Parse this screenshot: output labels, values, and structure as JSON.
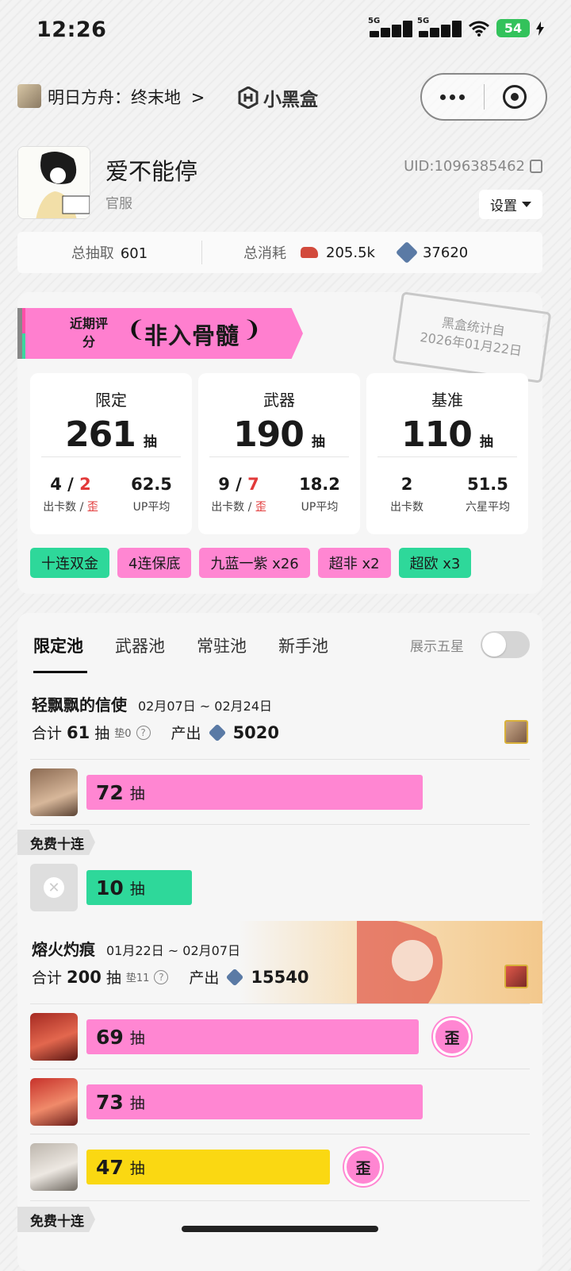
{
  "status": {
    "time": "12:26",
    "net1": "5G",
    "net2": "5G",
    "battery": "54"
  },
  "header": {
    "app_title": "明日方舟：终末地",
    "chevron": ">",
    "brand": "小黑盒"
  },
  "profile": {
    "name": "爱不能停",
    "server": "官服",
    "uid": "UID:1096385462",
    "settings": "设置"
  },
  "summary": {
    "total_pulls_label": "总抽取",
    "total_pulls": "601",
    "total_cost_label": "总消耗",
    "cost1": "205.5k",
    "cost2": "37620"
  },
  "rating": {
    "label": "近期评分",
    "value": "非入骨髓",
    "laurel_left": "❨",
    "laurel_right": "❩",
    "stamp_line1": "黑盒统计自",
    "stamp_line2": "2026年01月22日"
  },
  "stats": [
    {
      "title": "限定",
      "total": "261",
      "unit": "抽",
      "a_val1": "4",
      "a_sep": " / ",
      "a_val2": "2",
      "a_lbl1": "出卡数 / ",
      "a_lbl2": "歪",
      "b_val": "62.5",
      "b_lbl": "UP平均"
    },
    {
      "title": "武器",
      "total": "190",
      "unit": "抽",
      "a_val1": "9",
      "a_sep": " / ",
      "a_val2": "7",
      "a_lbl1": "出卡数 / ",
      "a_lbl2": "歪",
      "b_val": "18.2",
      "b_lbl": "UP平均"
    },
    {
      "title": "基准",
      "total": "110",
      "unit": "抽",
      "a_val1": "2",
      "a_lbl1": "出卡数",
      "b_val": "51.5",
      "b_lbl": "六星平均"
    }
  ],
  "chips": [
    "十连双金",
    "4连保底",
    "九蓝一紫 x26",
    "超非 x2",
    "超欧 x3"
  ],
  "tabs": [
    "限定池",
    "武器池",
    "常驻池",
    "新手池"
  ],
  "toggle_label": "展示五星",
  "pools": [
    {
      "name": "轻飘飘的信使",
      "date": "02月07日 ~ 02月24日",
      "total_label": "合计",
      "total": "61",
      "unit": "抽",
      "pad": "垫0",
      "help": "?",
      "output_label": "产出",
      "output": "5020"
    },
    {
      "name": "熔火灼痕",
      "date": "01月22日 ~ 02月07日",
      "total_label": "合计",
      "total": "200",
      "unit": "抽",
      "pad": "垫11",
      "help": "?",
      "output_label": "产出",
      "output": "15540"
    }
  ],
  "rows": [
    {
      "count": "72",
      "unit": "抽"
    },
    {
      "count": "10",
      "unit": "抽"
    },
    {
      "count": "69",
      "unit": "抽",
      "badge": "歪"
    },
    {
      "count": "73",
      "unit": "抽"
    },
    {
      "count": "47",
      "unit": "抽",
      "badge": "歪"
    }
  ],
  "free_tag": "免费十连",
  "free_tag2": "免费十连",
  "colors": {
    "pink": "#ff86d2",
    "green": "#2ed89a",
    "yellow": "#fad812"
  }
}
